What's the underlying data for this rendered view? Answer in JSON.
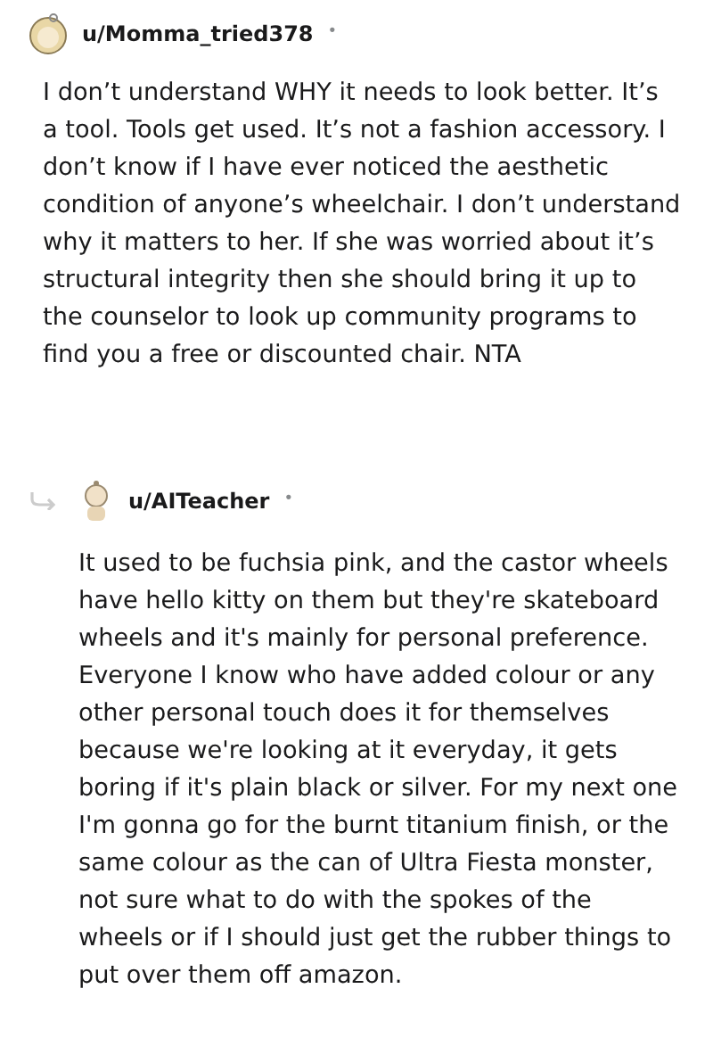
{
  "comments": [
    {
      "username": "u/Momma_tried378",
      "separator": "•",
      "is_reply": false,
      "body": "I don’t understand WHY it needs to look better. It’s a tool. Tools get used. It’s not a fashion accessory. I don’t know if I have ever noticed the aesthetic condition of anyone’s wheelchair. I don’t understand why it matters to her. If she was worried about it’s structural integrity then she should bring it up to the counselor to look up community programs to find you a free or discounted chair. NTA"
    },
    {
      "username": "u/AITeacher",
      "separator": "•",
      "is_reply": true,
      "body": "It used to be fuchsia pink, and the castor wheels have hello kitty on them but they're skateboard wheels and it's mainly for personal preference. Everyone I know who have added colour or any other personal touch does it for themselves because we're looking at it everyday, it gets boring if it's plain black or silver. For my next one I'm gonna go for the burnt titanium finish, or the same colour as the can of Ultra Fiesta monster, not sure what to do with the spokes of the wheels or if I should just get the rubber things to put over them off amazon."
    }
  ]
}
